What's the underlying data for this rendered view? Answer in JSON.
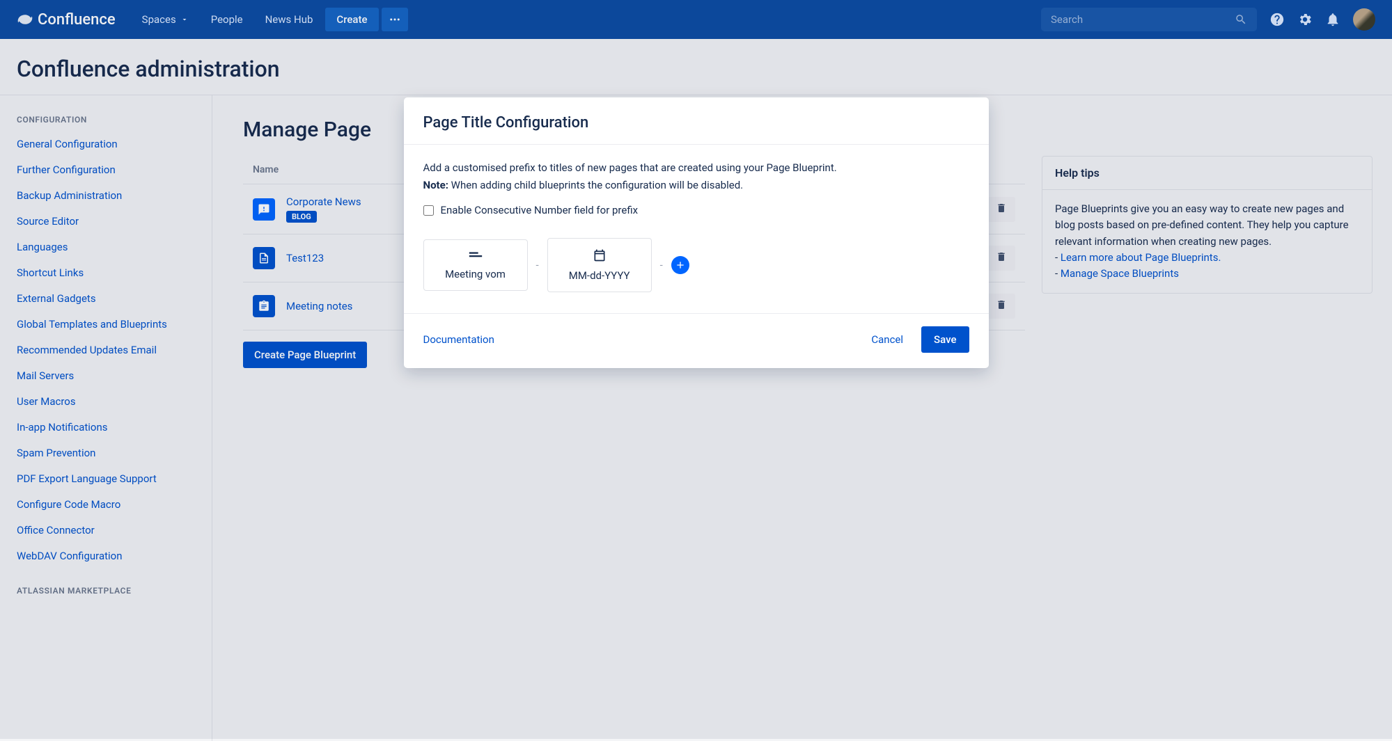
{
  "topnav": {
    "logo": "Confluence",
    "items": [
      "Spaces",
      "People",
      "News Hub"
    ],
    "create": "Create",
    "search_placeholder": "Search"
  },
  "page": {
    "title": "Confluence administration",
    "main_title": "Manage Page"
  },
  "sidebar": {
    "section1_header": "CONFIGURATION",
    "items": [
      "General Configuration",
      "Further Configuration",
      "Backup Administration",
      "Source Editor",
      "Languages",
      "Shortcut Links",
      "External Gadgets",
      "Global Templates and Blueprints",
      "Recommended Updates Email",
      "Mail Servers",
      "User Macros",
      "In-app Notifications",
      "Spam Prevention",
      "PDF Export Language Support",
      "Configure Code Macro",
      "Office Connector",
      "WebDAV Configuration"
    ],
    "section2_header": "ATLASSIAN MARKETPLACE"
  },
  "table": {
    "col_name": "Name",
    "rows": [
      {
        "name": "Corporate News",
        "badge": "BLOG",
        "icon": "chat"
      },
      {
        "name": "Test123",
        "badge": null,
        "icon": "doc"
      },
      {
        "name": "Meeting notes",
        "badge": null,
        "icon": "clipboard"
      }
    ],
    "create_btn": "Create Page Blueprint"
  },
  "help": {
    "title": "Help tips",
    "body": "Page Blueprints give you an easy way to create new pages and blog posts based on pre-defined content. They help you capture relevant information when creating new pages.",
    "link1": "Learn more about Page Blueprints.",
    "link2": "Manage Space Blueprints"
  },
  "modal": {
    "title": "Page Title Configuration",
    "desc": "Add a customised prefix to titles of new pages that are created using your Page Blueprint.",
    "note_label": "Note:",
    "note_text": " When adding child blueprints the configuration will be disabled.",
    "checkbox_label": "Enable Consecutive Number field for prefix",
    "chip1": "Meeting vom",
    "chip2": "MM-dd-YYYY",
    "doc_link": "Documentation",
    "cancel": "Cancel",
    "save": "Save"
  }
}
